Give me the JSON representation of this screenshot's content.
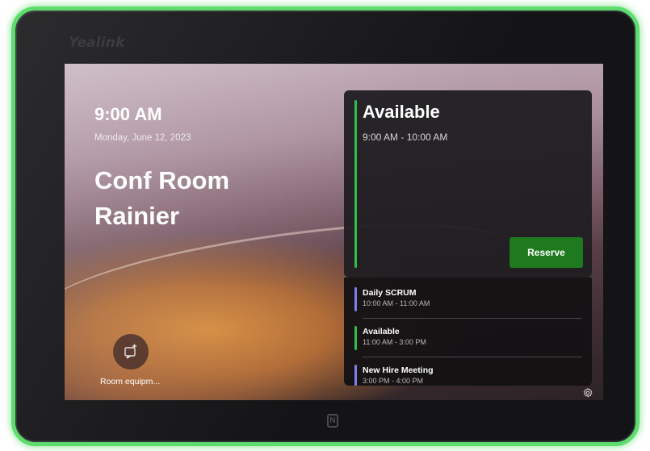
{
  "device": {
    "brand": "Yealink",
    "nfc_glyph": "N",
    "led_color": "#5fdc6e"
  },
  "screen": {
    "time": "9:00 AM",
    "date": "Monday, June 12, 2023",
    "room_name": "Conf Room Rainier",
    "equipment_label": "Room equipm..."
  },
  "status_card": {
    "title": "Available",
    "range": "9:00 AM - 10:00 AM",
    "reserve_label": "Reserve",
    "accent": "#2fbf4a",
    "button_color": "#1f7a1f"
  },
  "schedule": [
    {
      "title": "Daily SCRUM",
      "range": "10:00 AM - 11:00 AM",
      "color": "#7b7ff0"
    },
    {
      "title": "Available",
      "range": "11:00 AM - 3:00 PM",
      "color": "#2fbf4a"
    },
    {
      "title": "New Hire Meeting",
      "range": "3:00 PM - 4:00 PM",
      "color": "#7b7ff0"
    }
  ],
  "icons": {
    "equipment": "report-equipment-icon",
    "settings": "gear-icon",
    "nfc": "nfc-icon"
  }
}
